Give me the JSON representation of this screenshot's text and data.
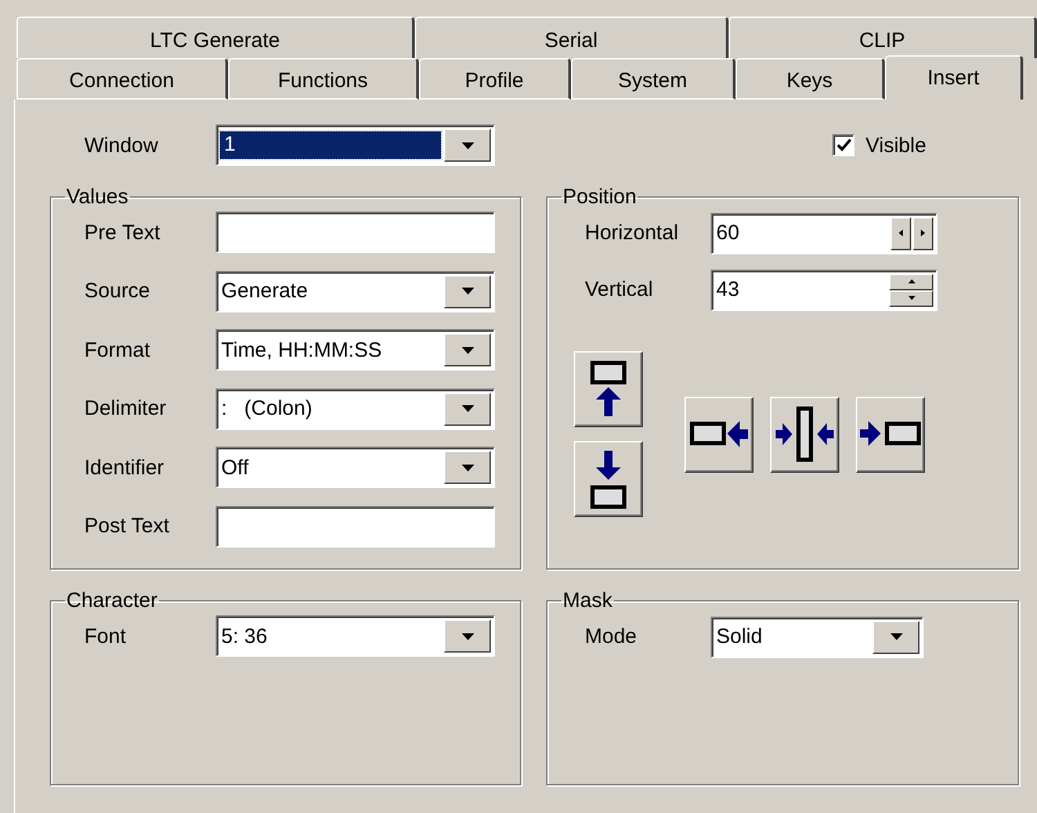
{
  "tab_rows": [
    [
      {
        "label": "LTC Generate",
        "selected": false
      },
      {
        "label": "Serial",
        "selected": false
      },
      {
        "label": "CLIP",
        "selected": false
      }
    ],
    [
      {
        "label": "Connection",
        "selected": false
      },
      {
        "label": "Functions",
        "selected": false
      },
      {
        "label": "Profile",
        "selected": false
      },
      {
        "label": "System",
        "selected": false
      },
      {
        "label": "Keys",
        "selected": false
      },
      {
        "label": "Insert",
        "selected": true
      }
    ]
  ],
  "window": {
    "label": "Window",
    "value": "1",
    "highlighted": true
  },
  "visible": {
    "label": "Visible",
    "checked": true
  },
  "values": {
    "title": "Values",
    "fields": [
      {
        "kind": "text",
        "label": "Pre Text"
      },
      {
        "kind": "combo",
        "label": "Source",
        "value": "Generate"
      },
      {
        "kind": "combo",
        "label": "Format",
        "value": "Time, HH:MM:SS"
      },
      {
        "kind": "combo",
        "label": "Delimiter",
        "value": ":   (Colon)"
      },
      {
        "kind": "combo",
        "label": "Identifier",
        "value": "Off"
      },
      {
        "kind": "text",
        "label": "Post Text"
      }
    ]
  },
  "position": {
    "title": "Position",
    "fields": [
      {
        "kind": "hspin",
        "label": "Horizontal",
        "value": "60"
      },
      {
        "kind": "vspin",
        "label": "Vertical",
        "value": "43"
      }
    ]
  },
  "character": {
    "title": "Character",
    "label": "Font",
    "value": "5: 36"
  },
  "mask": {
    "title": "Mask",
    "label": "Mode",
    "value": "Solid"
  }
}
